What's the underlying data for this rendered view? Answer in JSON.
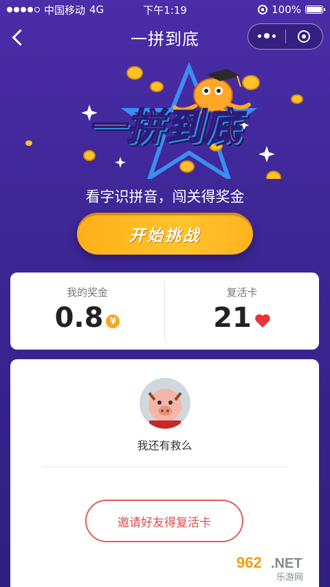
{
  "status_bar": {
    "carrier": "中国移动",
    "network": "4G",
    "time": "下午1:19",
    "battery": "100%"
  },
  "nav": {
    "title": "一拼到底"
  },
  "hero": {
    "logo_text": "一拼到底",
    "subtitle": "看字识拼音，闯关得奖金",
    "start_button": "开始挑战"
  },
  "stats": {
    "prize_label": "我的奖金",
    "prize_value": "0.8",
    "prize_icon": "¥",
    "revive_label": "复活卡",
    "revive_value": "21"
  },
  "user": {
    "name": "我还有救么"
  },
  "invite_button": "邀请好友得复活卡",
  "watermark": {
    "brand": "962.NET",
    "sub": "乐游网"
  },
  "colors": {
    "bg_top": "#4a2da8",
    "bg_bottom": "#30207f",
    "accent_orange": "#ffb01a",
    "invite_red": "#e24c4c",
    "heart_red": "#e8343a",
    "yen_gold": "#f5a623"
  }
}
